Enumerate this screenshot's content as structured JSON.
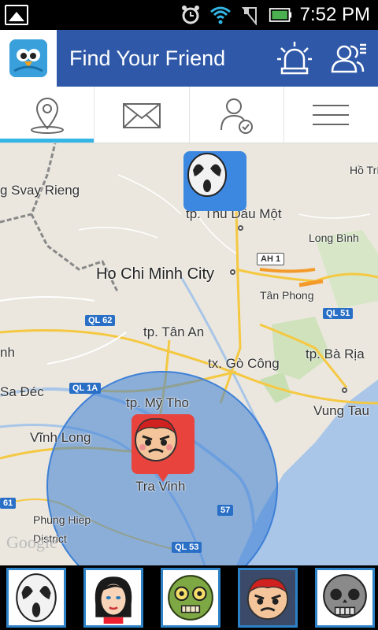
{
  "status": {
    "time": "7:52 PM"
  },
  "app": {
    "title": "Find Your Friend"
  },
  "tabs": [
    {
      "icon": "location-pin-icon",
      "active": true
    },
    {
      "icon": "mail-icon",
      "active": false
    },
    {
      "icon": "user-check-icon",
      "active": false
    },
    {
      "icon": "menu-icon",
      "active": false
    }
  ],
  "map": {
    "labels": {
      "svay_rieng": "g Svay Rieng",
      "thu_dau_mot": "tp. Thủ Dầu Một",
      "long_binh": "Long Bình",
      "ho_tri": "Hồ Trí",
      "hcmc": "Ho Chi Minh City",
      "tan_phong": "Tân Phong",
      "tan_an": "tp. Tân An",
      "go_cong": "tx. Gò Công",
      "ba_ria": "tp. Bà Rịa",
      "sa_dec": "Sa Đéc",
      "my_tho": "tp. Mỹ Tho",
      "vung_tau": "Vung Tau",
      "vinh_long": "Vĩnh Long",
      "tra_vinh": "Tra Vinh",
      "phung_hiep": "Phung Hiep",
      "district": "District",
      "nh": "nh",
      "google": "Google"
    },
    "shields": {
      "ah1": "AH 1",
      "ql62": "QL 62",
      "ql51": "QL 51",
      "ql1a": "QL 1A",
      "r57": "57",
      "ql53": "QL 53",
      "r61": "61"
    }
  },
  "friends": [
    {
      "name": "ghost-face-avatar",
      "selected": false
    },
    {
      "name": "woman-avatar",
      "selected": false
    },
    {
      "name": "zombie-avatar",
      "selected": false
    },
    {
      "name": "angry-face-avatar",
      "selected": true
    },
    {
      "name": "skull-avatar",
      "selected": false
    }
  ]
}
